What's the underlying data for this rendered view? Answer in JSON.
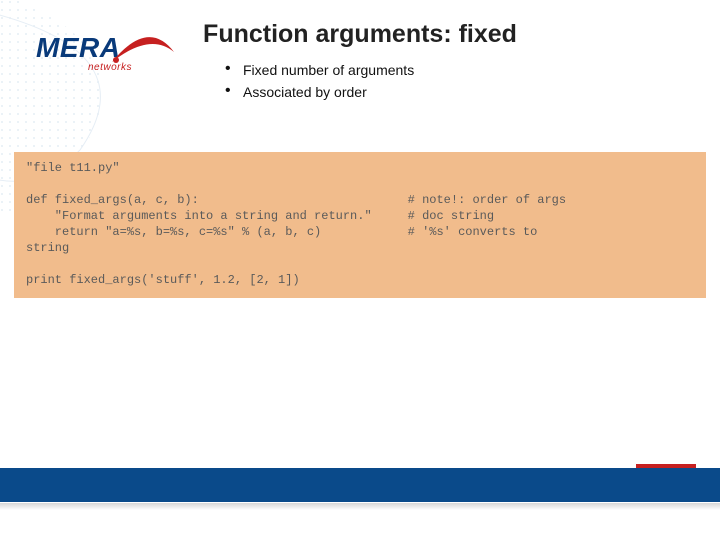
{
  "logo": {
    "main": "MERA",
    "sub": "networks"
  },
  "title": "Function arguments: fixed",
  "bullets": [
    "Fixed number of arguments",
    "Associated by order"
  ],
  "code": "\"file t11.py\"\n\ndef fixed_args(a, c, b):                             # note!: order of args\n    \"Format arguments into a string and return.\"     # doc string\n    return \"a=%s, b=%s, c=%s\" % (a, b, c)            # '%s' converts to\nstring\n\nprint fixed_args('stuff', 1.2, [2, 1])"
}
